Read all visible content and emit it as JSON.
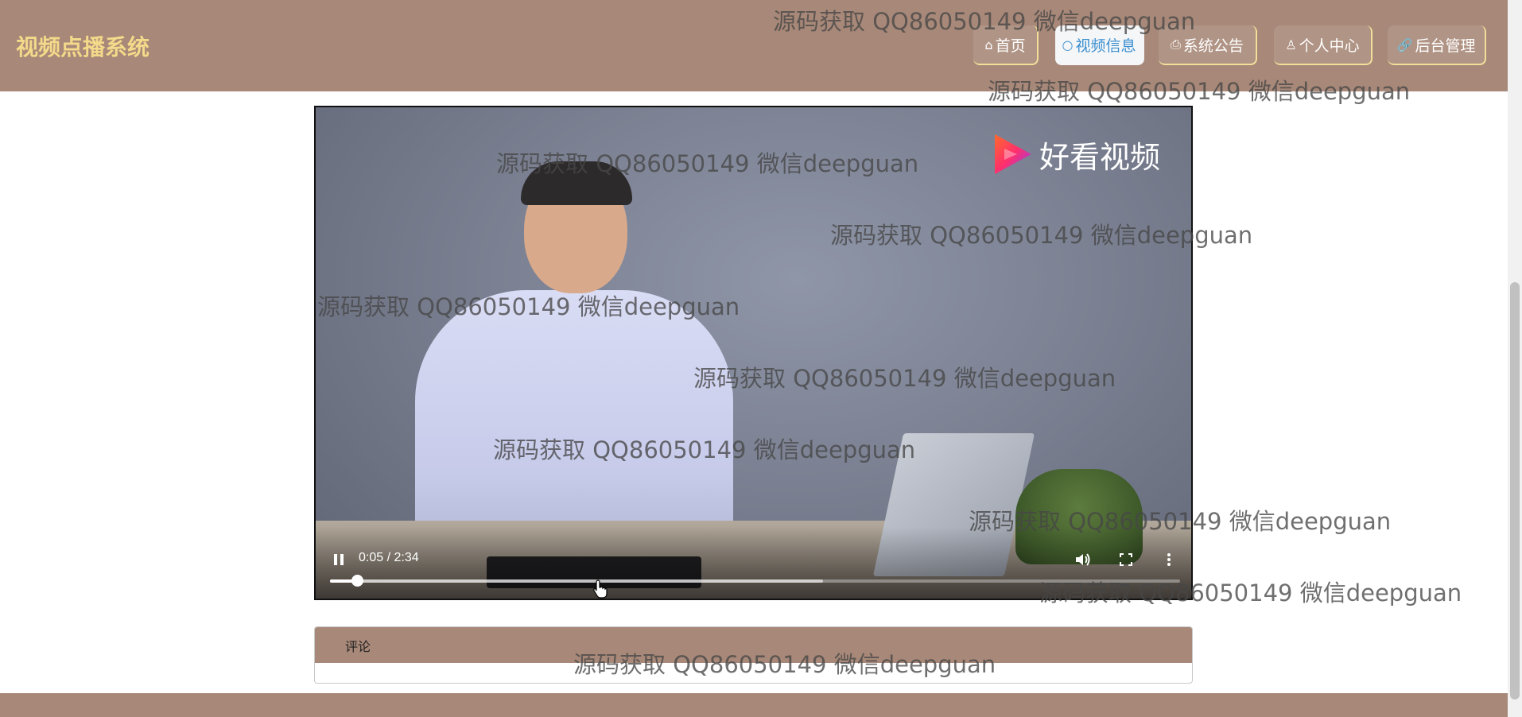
{
  "header": {
    "brand": "视频点播系统",
    "nav": [
      {
        "icon": "home-icon",
        "glyph": "⌂",
        "label": "首页",
        "active": false
      },
      {
        "icon": "circle-icon",
        "glyph": "○",
        "label": "视频信息",
        "active": true
      },
      {
        "icon": "printer-icon",
        "glyph": "⎙",
        "label": "系统公告",
        "active": false
      },
      {
        "icon": "user-icon",
        "glyph": "♙",
        "label": "个人中心",
        "active": false
      },
      {
        "icon": "link-icon",
        "glyph": "🔗",
        "label": "后台管理",
        "active": false
      }
    ]
  },
  "player": {
    "logo_text": "好看视频",
    "time": "0:05 / 2:34",
    "progress_played": 0.032,
    "progress_buffered": 0.58,
    "controls": {
      "play_pause": "pause-icon",
      "volume": "volume-icon",
      "fullscreen": "fullscreen-icon",
      "more": "more-vertical-icon"
    }
  },
  "comments": {
    "title": "评论"
  },
  "watermark": {
    "text": "源码获取 QQ86050149 微信deepguan"
  },
  "colors": {
    "header_bg": "#a88878",
    "brand_text": "#f3d98a",
    "nav_border": "#f1df9a",
    "nav_active_text": "#3b8fd0"
  }
}
